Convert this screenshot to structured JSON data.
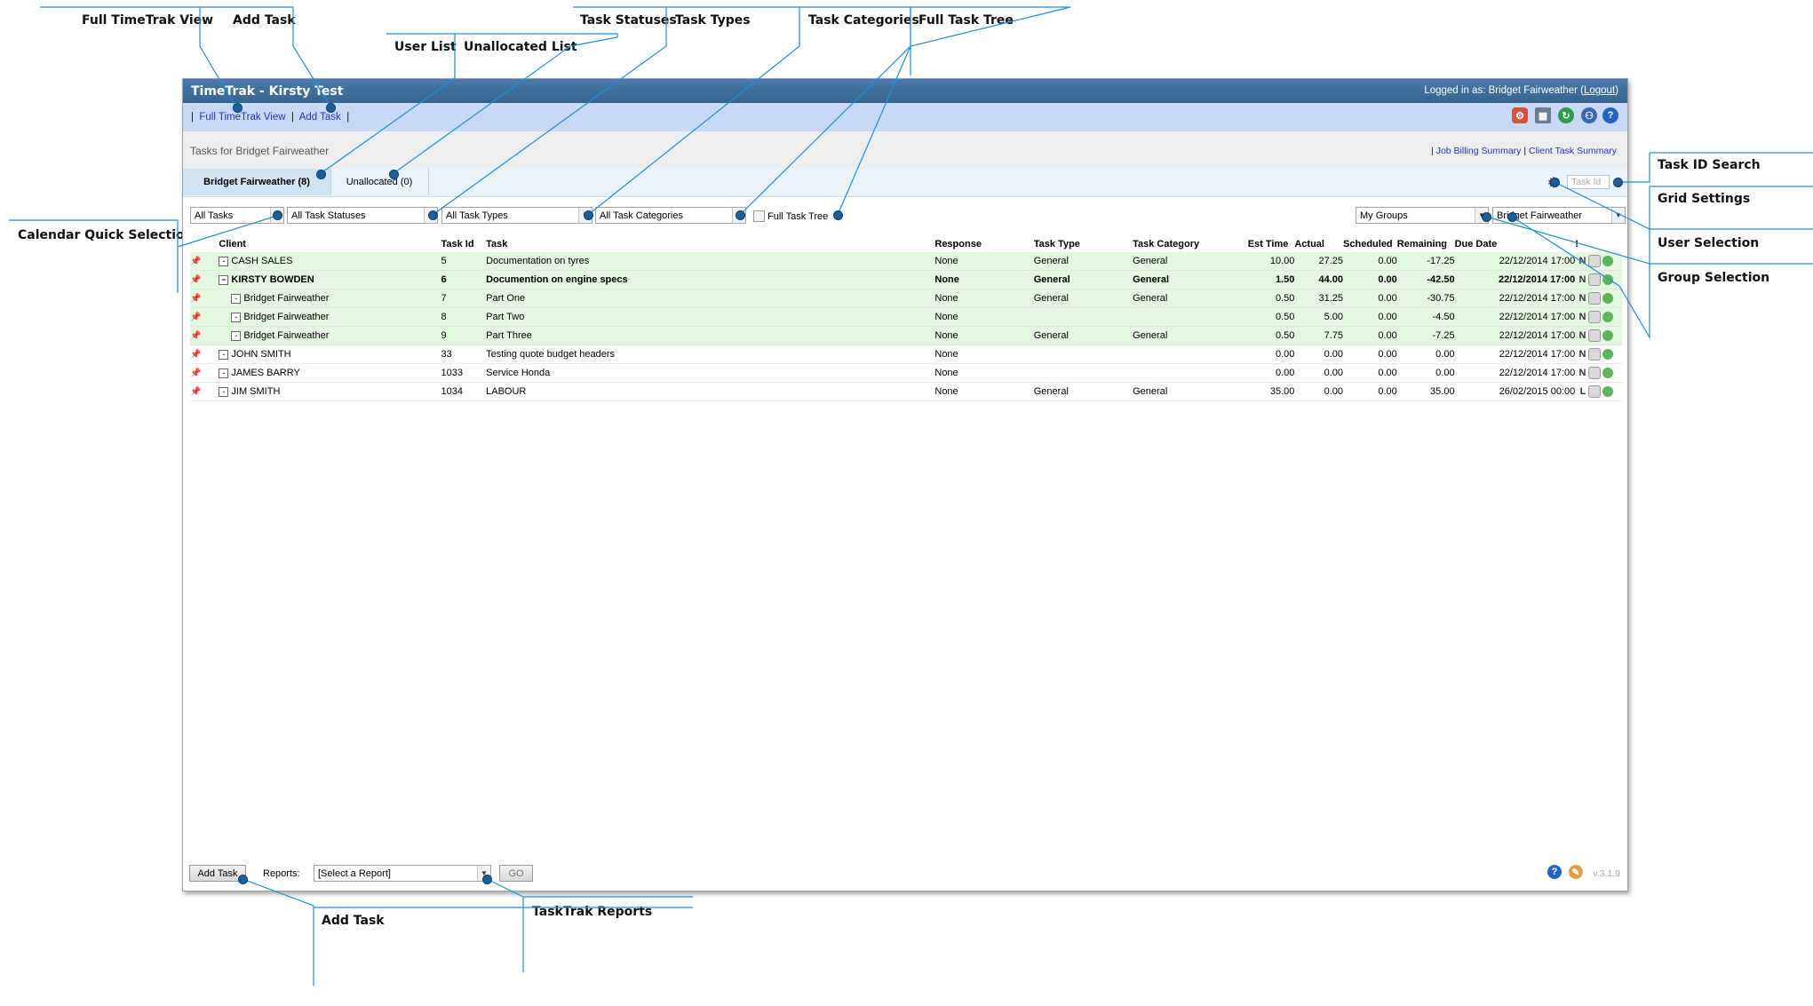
{
  "callouts": {
    "full_view": "Full TimeTrak View",
    "add_task_top": "Add Task",
    "user_list": "User List",
    "unallocated_list": "Unallocated List",
    "task_statuses": "Task Statuses",
    "task_types": "Task Types",
    "task_categories": "Task Categories",
    "full_task_tree": "Full Task Tree",
    "calendar_quick": "Calendar Quick Selection",
    "task_id_search": "Task ID Search",
    "grid_settings": "Grid Settings",
    "user_selection": "User Selection",
    "group_selection": "Group Selection",
    "add_task_bottom": "Add Task",
    "tasktrak_reports": "TaskTrak Reports"
  },
  "app": {
    "title": "TimeTrak - Kirsty Test",
    "logged_in_prefix": "Logged in as: Bridget Fairweather (",
    "logout": "Logout",
    "logged_in_suffix": ")",
    "nav": {
      "sep": "|",
      "full_view": "Full TimeTrak View",
      "add_task": "Add Task"
    },
    "toolbar_icons": [
      "user-settings-icon",
      "calendar-icon",
      "refresh-icon",
      "users-icon",
      "help-icon"
    ],
    "heading": "Tasks for Bridget Fairweather",
    "summary_links": {
      "sep": "|",
      "job_billing": "Job Billing Summary",
      "client_task": "Client Task Summary"
    },
    "tabs": {
      "user": "Bridget Fairweather (8)",
      "unallocated": "Unallocated (0)"
    },
    "task_id_placeholder": "Task Id",
    "filters": {
      "tasks": "All Tasks",
      "statuses": "All Task Statuses",
      "types": "All Task Types",
      "categories": "All Task Categories",
      "full_tree": "Full Task Tree",
      "groups": "My Groups",
      "user": "Bridget Fairweather"
    },
    "columns": {
      "client": "Client",
      "task_id": "Task Id",
      "task": "Task",
      "response": "Response",
      "task_type": "Task Type",
      "task_category": "Task Category",
      "est_time": "Est Time",
      "actual": "Actual",
      "scheduled": "Scheduled",
      "remaining": "Remaining",
      "due_date": "Due Date",
      "flag": "!"
    },
    "rows": [
      {
        "client": "CASH SALES",
        "toggle": "-",
        "id": "5",
        "task": "Documentation on tyres",
        "response": "None",
        "type": "General",
        "category": "General",
        "est": "10.00",
        "actual": "27.25",
        "scheduled": "0.00",
        "remaining": "-17.25",
        "due": "22/12/2014 17:00",
        "flag": "N"
      },
      {
        "client": "KIRSTY BOWDEN",
        "toggle": "−",
        "id": "6",
        "task": "Documention on engine specs",
        "response": "None",
        "type": "General",
        "category": "General",
        "est": "1.50",
        "actual": "44.00",
        "scheduled": "0.00",
        "remaining": "-42.50",
        "due": "22/12/2014 17:00",
        "flag": "N"
      },
      {
        "client": "Bridget Fairweather",
        "toggle": "-",
        "id": "7",
        "task": "Part One",
        "response": "None",
        "type": "General",
        "category": "General",
        "est": "0.50",
        "actual": "31.25",
        "scheduled": "0.00",
        "remaining": "-30.75",
        "due": "22/12/2014 17:00",
        "flag": "N"
      },
      {
        "client": "Bridget Fairweather",
        "toggle": "-",
        "id": "8",
        "task": "Part Two",
        "response": "None",
        "type": "",
        "category": "",
        "est": "0.50",
        "actual": "5.00",
        "scheduled": "0.00",
        "remaining": "-4.50",
        "due": "22/12/2014 17:00",
        "flag": "N"
      },
      {
        "client": "Bridget Fairweather",
        "toggle": "-",
        "id": "9",
        "task": "Part Three",
        "response": "None",
        "type": "General",
        "category": "General",
        "est": "0.50",
        "actual": "7.75",
        "scheduled": "0.00",
        "remaining": "-7.25",
        "due": "22/12/2014 17:00",
        "flag": "N"
      },
      {
        "client": "JOHN SMITH",
        "toggle": "-",
        "id": "33",
        "task": "Testing quote budget headers",
        "response": "None",
        "type": "",
        "category": "",
        "est": "0.00",
        "actual": "0.00",
        "scheduled": "0.00",
        "remaining": "0.00",
        "due": "22/12/2014 17:00",
        "flag": "N"
      },
      {
        "client": "JAMES BARRY",
        "toggle": "-",
        "id": "1033",
        "task": "Service Honda",
        "response": "None",
        "type": "",
        "category": "",
        "est": "0.00",
        "actual": "0.00",
        "scheduled": "0.00",
        "remaining": "0.00",
        "due": "22/12/2014 17:00",
        "flag": "N"
      },
      {
        "client": "JIM SMITH",
        "toggle": "-",
        "id": "1034",
        "task": "LABOUR",
        "response": "None",
        "type": "General",
        "category": "General",
        "est": "35.00",
        "actual": "0.00",
        "scheduled": "0.00",
        "remaining": "35.00",
        "due": "26/02/2015 00:00",
        "flag": "L"
      }
    ],
    "footer": {
      "add_task": "Add Task",
      "reports_label": "Reports:",
      "report_select": "[Select a Report]",
      "go": "GO",
      "version": "v.3.1.9"
    },
    "colors": {
      "title_bar": "#3f6f9f",
      "nav_bar": "#c8d9f6",
      "row_green": "#e4f7e0",
      "callout_line": "#1f8fd6",
      "marker": "#1b5f99"
    }
  }
}
